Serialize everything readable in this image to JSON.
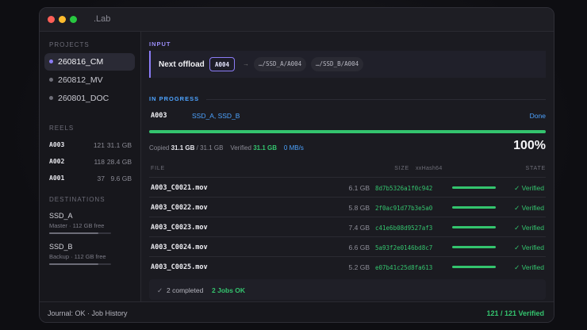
{
  "window": {
    "title": ".Lab"
  },
  "sidebar": {
    "projects_label": "PROJECTS",
    "projects": [
      {
        "name": "260816_CM",
        "active": true
      },
      {
        "name": "260812_MV",
        "active": false
      },
      {
        "name": "260801_DOC",
        "active": false
      }
    ],
    "reels_label": "REELS",
    "reels": [
      {
        "name": "A003",
        "count": "121",
        "size": "31.1 GB"
      },
      {
        "name": "A002",
        "count": "118",
        "size": "28.4 GB"
      },
      {
        "name": "A001",
        "count": "37",
        "size": "9.6 GB"
      }
    ],
    "destinations_label": "DESTINATIONS",
    "destinations": [
      {
        "name": "SSD_A",
        "detail": "Master · 112 GB free",
        "usage": 0.8
      },
      {
        "name": "SSD_B",
        "detail": "Backup · 112 GB free",
        "usage": 0.8
      }
    ]
  },
  "input": {
    "label": "INPUT",
    "next_offload_label": "Next offload",
    "reel": "A004",
    "arrow": "→",
    "dest_a": "…/SSD_A/A004",
    "dest_b": "…/SSD_B/A004"
  },
  "progress": {
    "label": "IN PROGRESS",
    "job": "A003",
    "destinations": "SSD_A, SSD_B",
    "status": "Done",
    "fraction": 1.0,
    "copied_label": "Copied",
    "copied": "31.1 GB",
    "total": "/ 31.1 GB",
    "verified_label": "Verified",
    "verified": "31.1 GB",
    "speed": "0 MB/s",
    "percent": "100%"
  },
  "table": {
    "headers": {
      "file": "FILE",
      "size": "SIZE",
      "hash": "xxHash64",
      "state": "STATE"
    },
    "rows": [
      {
        "file": "A003_C0021.mov",
        "size": "6.1 GB",
        "hash": "8d7b5326a1f0c942",
        "state": "✓ Verified"
      },
      {
        "file": "A003_C0022.mov",
        "size": "5.8 GB",
        "hash": "2f0ac91d77b3e5a0",
        "state": "✓ Verified"
      },
      {
        "file": "A003_C0023.mov",
        "size": "7.4 GB",
        "hash": "c41e6b08d9527af3",
        "state": "✓ Verified"
      },
      {
        "file": "A003_C0024.mov",
        "size": "6.6 GB",
        "hash": "5a93f2e0146bd8c7",
        "state": "✓ Verified"
      },
      {
        "file": "A003_C0025.mov",
        "size": "5.2 GB",
        "hash": "e07b41c25d8fa613",
        "state": "✓ Verified"
      }
    ]
  },
  "summary": {
    "check": "✓",
    "completed": "2 completed",
    "jobs": "2 Jobs OK"
  },
  "footer": {
    "left": "Journal: OK  ·  Job History",
    "right": "121 / 121 Verified"
  },
  "colors": {
    "accent": "#8b7cf6",
    "green": "#34c46e",
    "blue": "#4da3ff"
  }
}
